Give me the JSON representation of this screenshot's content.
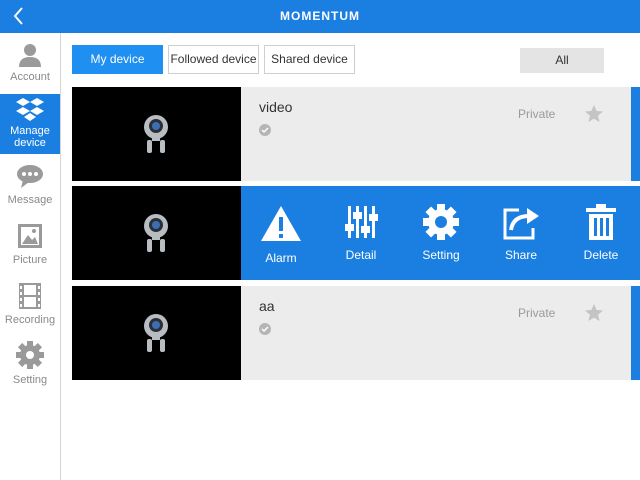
{
  "header": {
    "brand": "MOMENTUM",
    "back_icon": "chevron-left-icon"
  },
  "sidebar": {
    "items": [
      {
        "label": "Account",
        "icon": "user-icon",
        "active": false
      },
      {
        "label": "Manage device",
        "label_lines": [
          "Manage",
          "device"
        ],
        "icon": "dropbox-icon",
        "active": true
      },
      {
        "label": "Message",
        "icon": "chat-bubble-icon",
        "active": false
      },
      {
        "label": "Picture",
        "icon": "picture-icon",
        "active": false
      },
      {
        "label": "Recording",
        "icon": "film-icon",
        "active": false
      },
      {
        "label": "Setting",
        "icon": "gear-icon",
        "active": false
      }
    ]
  },
  "tabs": [
    {
      "label": "My device",
      "active": true
    },
    {
      "label": "Followed device",
      "active": false
    },
    {
      "label": "Shared device",
      "active": false
    }
  ],
  "filter": {
    "label": "All"
  },
  "devices": [
    {
      "name": "video",
      "privacy": "Private",
      "status_icon": "check-circle-icon",
      "favorite_icon": "star-icon"
    },
    {
      "name": "",
      "actions_open": true
    },
    {
      "name": "aa",
      "privacy": "Private",
      "status_icon": "check-circle-icon",
      "favorite_icon": "star-icon"
    }
  ],
  "actions": [
    {
      "label": "Alarm",
      "icon": "warning-icon"
    },
    {
      "label": "Detail",
      "icon": "sliders-icon"
    },
    {
      "label": "Setting",
      "icon": "gear-icon"
    },
    {
      "label": "Share",
      "icon": "share-icon"
    },
    {
      "label": "Delete",
      "icon": "trash-icon"
    }
  ],
  "colors": {
    "accent": "#1a7fe0",
    "row_bg": "#ececec",
    "thumb_bg": "#000000",
    "muted": "#8a8a8a"
  }
}
